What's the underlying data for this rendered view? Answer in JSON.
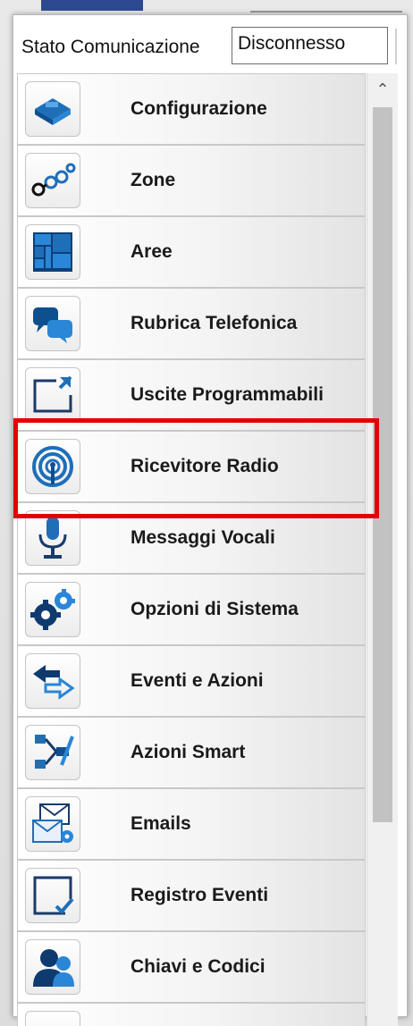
{
  "status": {
    "label": "Stato Comunicazione",
    "value": "Disconnesso"
  },
  "menu": {
    "items": [
      {
        "label": "Configurazione",
        "icon": "configuration-icon"
      },
      {
        "label": "Zone",
        "icon": "zones-icon"
      },
      {
        "label": "Aree",
        "icon": "areas-icon"
      },
      {
        "label": "Rubrica Telefonica",
        "icon": "phonebook-icon"
      },
      {
        "label": "Uscite Programmabili",
        "icon": "programmable-outputs-icon"
      },
      {
        "label": "Ricevitore Radio",
        "icon": "radio-receiver-icon"
      },
      {
        "label": "Messaggi Vocali",
        "icon": "microphone-icon"
      },
      {
        "label": "Opzioni di Sistema",
        "icon": "gears-icon"
      },
      {
        "label": "Eventi e Azioni",
        "icon": "arrows-icon"
      },
      {
        "label": "Azioni Smart",
        "icon": "smart-actions-icon"
      },
      {
        "label": "Emails",
        "icon": "email-icon"
      },
      {
        "label": "Registro Eventi",
        "icon": "event-log-icon"
      },
      {
        "label": "Chiavi e Codici",
        "icon": "users-keys-icon"
      }
    ],
    "highlighted_item": "Ricevitore Radio"
  },
  "colors": {
    "highlight_border": "#e30000",
    "icon_blue": "#1f6fb8"
  }
}
